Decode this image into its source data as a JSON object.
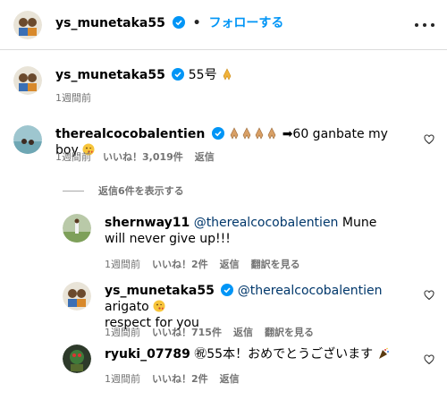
{
  "header": {
    "username": "ys_munetaka55",
    "separator": "•",
    "follow_label": "フォローする"
  },
  "caption": {
    "username": "ys_munetaka55",
    "text": "55号",
    "time": "1週間前"
  },
  "comments": [
    {
      "username": "therealcocobalentien",
      "text": "➡60 ganbate my boy",
      "time": "1週間前",
      "likes": "いいね！3,019件",
      "reply_label": "返信"
    }
  ],
  "view_replies_label": "返信6件を表示する",
  "replies": [
    {
      "username": "shernway11",
      "mention": "@therealcocobalentien",
      "text": " Mune will never give up!!!",
      "time": "1週間前",
      "likes": "いいね！2件",
      "reply_label": "返信",
      "translate_label": "翻訳を見る"
    },
    {
      "username": "ys_munetaka55",
      "mention": "@therealcocobalentien",
      "text": " arigato",
      "text2": "respect for you",
      "time": "1週間前",
      "likes": "いいね！715件",
      "reply_label": "返信",
      "translate_label": "翻訳を見る"
    },
    {
      "username": "ryuki_07789",
      "text": "㊗55本！おめでとうございます",
      "time": "1週間前",
      "likes": "いいね！2件",
      "reply_label": "返信"
    }
  ],
  "icons": {
    "verified": "verified-badge-icon",
    "heart": "heart-outline-icon",
    "more": "more-horizontal-icon",
    "pray": "folded-hands-emoji"
  },
  "colors": {
    "link_blue": "#0095f6",
    "verified_blue": "#0095f6",
    "meta_gray": "#737373"
  }
}
